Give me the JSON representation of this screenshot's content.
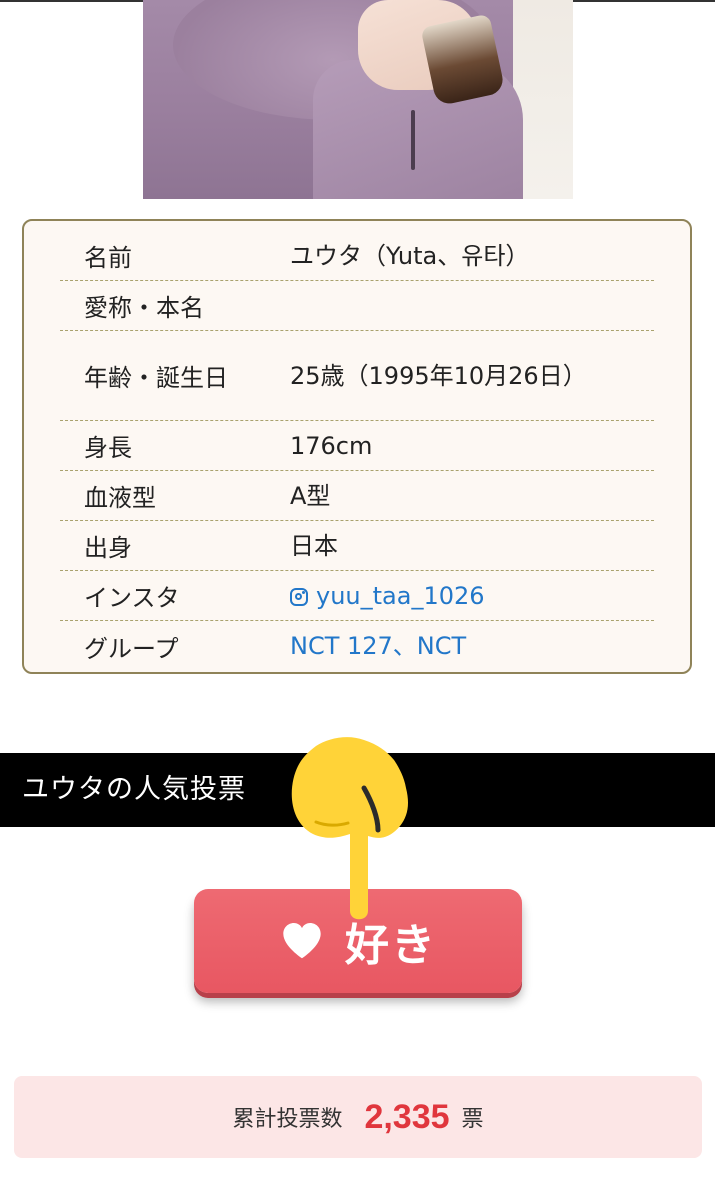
{
  "profile": {
    "rows": [
      {
        "key": "名前",
        "value": "ユウタ（Yuta、유타）"
      },
      {
        "key": "愛称・本名",
        "value": ""
      },
      {
        "key": "年齢・誕生日",
        "value": "25歳（1995年10月26日）"
      },
      {
        "key": "身長",
        "value": "176cm"
      },
      {
        "key": "血液型",
        "value": "A型"
      },
      {
        "key": "出身",
        "value": "日本"
      },
      {
        "key": "インスタ",
        "value": "yuu_taa_1026"
      },
      {
        "key": "グループ",
        "value": "NCT 127、NCT"
      }
    ]
  },
  "vote": {
    "section_title": "ユウタの人気投票",
    "like_label": "好き",
    "total_label": "累計投票数",
    "total_count": "2,335",
    "total_unit": "票"
  },
  "icons": {
    "instagram": "instagram-icon",
    "heart": "heart-icon",
    "pointer": "pointing-down-hand-icon"
  },
  "colors": {
    "link": "#2277c9",
    "button": "#e85762",
    "count": "#e0363d",
    "band": "#000000"
  }
}
